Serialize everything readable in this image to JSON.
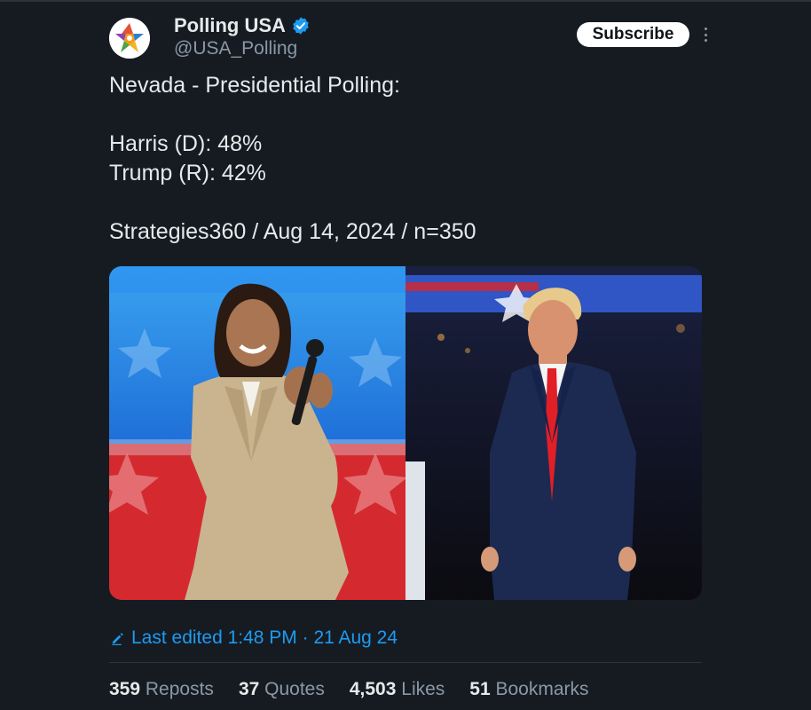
{
  "author": {
    "name": "Polling USA",
    "handle": "@USA_Polling",
    "verified": true,
    "verified_color": "#1d9bf0",
    "avatar_icon": "star-logo-icon"
  },
  "actions": {
    "subscribe_label": "Subscribe",
    "more_icon": "more-vertical-icon"
  },
  "post": {
    "lines": [
      "Nevada - Presidential Polling:",
      "",
      "Harris (D): 48%",
      "Trump (R): 42%",
      "",
      "Strategies360 / Aug 14, 2024 / n=350"
    ]
  },
  "media": {
    "left_image": "photo-harris",
    "right_image": "photo-trump"
  },
  "edited": {
    "icon": "pencil-icon",
    "text": "Last edited 1:48 PM · 21 Aug 24"
  },
  "stats": [
    {
      "count": "359",
      "label": "Reposts"
    },
    {
      "count": "37",
      "label": "Quotes"
    },
    {
      "count": "4,503",
      "label": "Likes"
    },
    {
      "count": "51",
      "label": "Bookmarks"
    }
  ],
  "colors": {
    "background": "#161b22",
    "text": "#e7e9ea",
    "muted": "#8b98a5",
    "accent": "#1d9bf0"
  }
}
